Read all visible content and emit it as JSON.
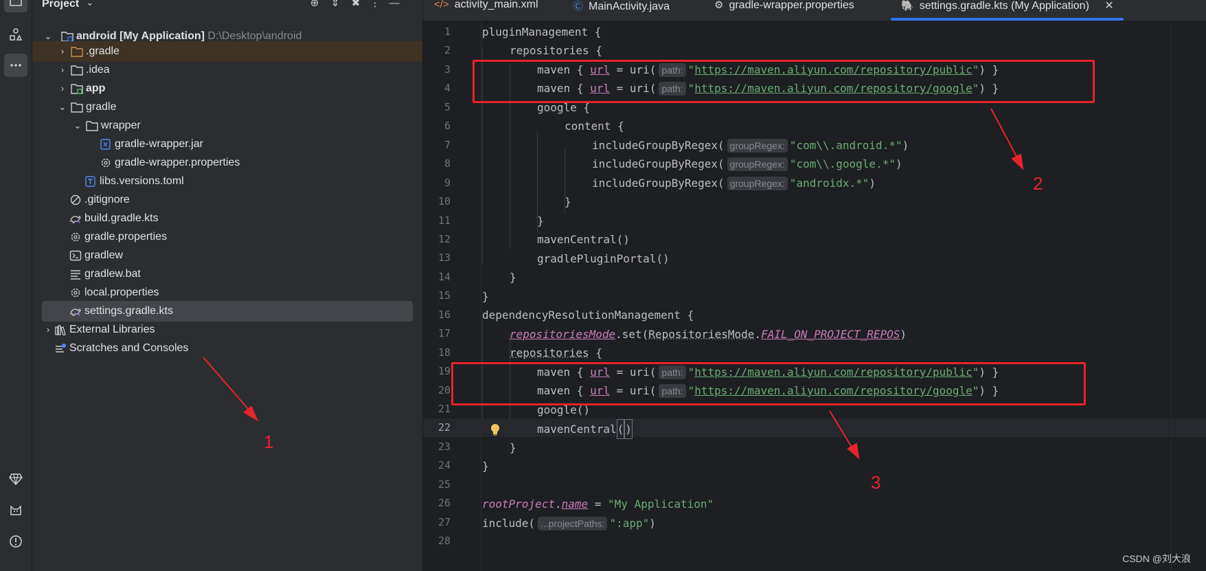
{
  "sidebar_tools": [
    "folder-icon",
    "structure-icon",
    "more-icon",
    "gem-icon",
    "cat-icon",
    "problems-icon"
  ],
  "project_panel": {
    "title": "Project",
    "tree": [
      {
        "label": "android",
        "suffix": "[My Application]",
        "path": "D:\\Desktop\\android",
        "icon": "module-folder-icon"
      },
      {
        "label": ".gradle",
        "icon": "folder-icon"
      },
      {
        "label": ".idea",
        "icon": "folder-icon"
      },
      {
        "label": "app",
        "icon": "module-folder-icon"
      },
      {
        "label": "gradle",
        "icon": "folder-icon"
      },
      {
        "label": "wrapper",
        "icon": "folder-icon"
      },
      {
        "label": "gradle-wrapper.jar",
        "icon": "jar-icon"
      },
      {
        "label": "gradle-wrapper.properties",
        "icon": "gear-icon"
      },
      {
        "label": "libs.versions.toml",
        "icon": "toml-icon"
      },
      {
        "label": ".gitignore",
        "icon": "ignore-icon"
      },
      {
        "label": "build.gradle.kts",
        "icon": "gradle-icon"
      },
      {
        "label": "gradle.properties",
        "icon": "gear-icon"
      },
      {
        "label": "gradlew",
        "icon": "terminal-icon"
      },
      {
        "label": "gradlew.bat",
        "icon": "text-lines-icon"
      },
      {
        "label": "local.properties",
        "icon": "gear-icon"
      },
      {
        "label": "settings.gradle.kts",
        "icon": "gradle-icon"
      },
      {
        "label": "External Libraries",
        "icon": "library-icon"
      },
      {
        "label": "Scratches and Consoles",
        "icon": "scratches-icon"
      }
    ]
  },
  "tabs": [
    {
      "label": "activity_main.xml",
      "icon": "xml-icon"
    },
    {
      "label": "MainActivity.java",
      "icon": "class-icon"
    },
    {
      "label": "gradle-wrapper.properties",
      "icon": "gear-icon"
    },
    {
      "label": "settings.gradle.kts (My Application)",
      "icon": "gradle-icon",
      "active": true
    }
  ],
  "editor": {
    "line_numbers": [
      "1",
      "2",
      "3",
      "4",
      "5",
      "6",
      "7",
      "8",
      "9",
      "10",
      "11",
      "12",
      "13",
      "14",
      "15",
      "16",
      "17",
      "18",
      "19",
      "20",
      "21",
      "22",
      "23",
      "24",
      "25",
      "26",
      "27",
      "28"
    ],
    "current_line": "22",
    "hints": {
      "path": "path:",
      "groupRegex": "groupRegex:",
      "projectPaths": "...projectPaths:"
    },
    "urls": {
      "public": "https://maven.aliyun.com/repository/public",
      "google": "https://maven.aliyun.com/repository/google"
    },
    "text": {
      "pluginManagement": "pluginManagement {",
      "repositories": "repositories {",
      "maven_open": "maven { ",
      "url": "url",
      "eq_uri": " = uri(",
      "close_maven": ") }",
      "google_open": "google {",
      "content": "content {",
      "includeGroupByRegex": "includeGroupByRegex(",
      "regex_android": "\"com\\\\.android.*\"",
      "regex_google": "\"com\\\\.google.*\"",
      "regex_androidx": "\"androidx.*\"",
      "close_paren": ")",
      "brace": "}",
      "mavenCentral": "mavenCentral()",
      "gradlePluginPortal": "gradlePluginPortal()",
      "dependencyResolutionManagement": "dependencyResolutionManagement {",
      "repositoriesMode": "repositoriesMode",
      "set_open": ".set(",
      "RepositoriesMode": "RepositoriesMode",
      "FAIL": "FAIL_ON_PROJECT_REPOS",
      "repositories_plain": "repositories",
      "open_brace": " {",
      "google_call": "google()",
      "mavenCentral_name": "mavenCentral",
      "rootProject": "rootProject",
      "name": "name",
      "eq": " = ",
      "app_name": "\"My Application\"",
      "include": "include(",
      "app_module": "\":app\""
    }
  },
  "annotations": {
    "one": "1",
    "two": "2",
    "three": "3"
  },
  "watermark": "CSDN @刘大浪",
  "colors": {
    "accent": "#3574f0",
    "annotation_red": "#e8232b",
    "string": "#6aab73",
    "property": "#c77dbb"
  }
}
